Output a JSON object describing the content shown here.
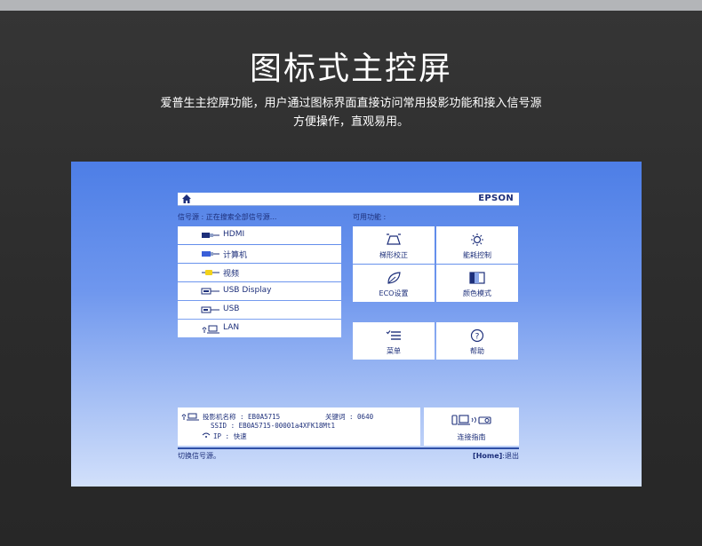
{
  "page": {
    "title": "图标式主控屏",
    "description_lines": [
      "爱普生主控屏功能，用户通过图标界面直接访问常用投影功能和接入信号源",
      "方便操作，直观易用。"
    ]
  },
  "screen": {
    "brand": "EPSON",
    "source_label": "信号源 : 正在搜索全部信号源...",
    "functions_label": "可用功能 :",
    "sources": [
      {
        "label": "HDMI",
        "icon": "hdmi-icon"
      },
      {
        "label": "计算机",
        "icon": "computer-vga-icon"
      },
      {
        "label": "视频",
        "icon": "video-rca-icon"
      },
      {
        "label": "USB Display",
        "icon": "usb-display-icon"
      },
      {
        "label": "USB",
        "icon": "usb-icon"
      },
      {
        "label": "LAN",
        "icon": "lan-icon"
      }
    ],
    "functions": [
      {
        "label": "梯形校正",
        "icon": "keystone-icon"
      },
      {
        "label": "能耗控制",
        "icon": "brightness-icon"
      },
      {
        "label": "ECO设置",
        "icon": "eco-leaf-icon"
      },
      {
        "label": "颜色模式",
        "icon": "color-mode-icon"
      },
      {
        "label": "菜单",
        "icon": "menu-list-icon"
      },
      {
        "label": "帮助",
        "icon": "help-icon"
      }
    ],
    "info": {
      "projector_name_label": "投影机名称 :",
      "projector_name_value": "EB0A5715",
      "keyword_label": "关键词 :",
      "keyword_value": "0640",
      "ssid_label": "SSID :",
      "ssid_value": "EB0A5715-00001a4XFK18Mt1",
      "ip_label": "IP :",
      "ip_value": "快速"
    },
    "guide_label": "连接指南",
    "footer_left": "切换信号源。",
    "footer_right_key": "[Home]",
    "footer_right_text": ":退出"
  },
  "colors": {
    "ui_text": "#1d2f7a",
    "screen_top": "#4d7ee6",
    "screen_bottom": "#d2e0fb"
  }
}
